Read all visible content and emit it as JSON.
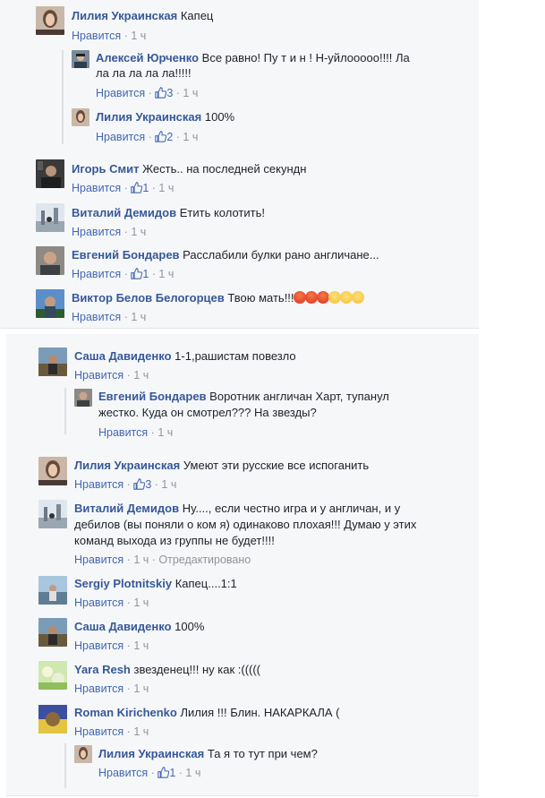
{
  "colors": {
    "name": "#365899",
    "link": "#4267b2",
    "meta": "#90949c",
    "panel": "#f6f7f9"
  },
  "panel1": {
    "c1": {
      "name": "Лилия Украинская",
      "text": "Капец",
      "like": "Нравится",
      "time": "1 ч"
    },
    "r1": {
      "name": "Алексей Юрченко",
      "text_l1": "Все равно! Пу т и н ! Н-уйлооооо!!!! Ла",
      "text_l2": "ла ла ла ла ла!!!!!",
      "like": "Нравится",
      "likes": "3",
      "time": "1 ч"
    },
    "r2": {
      "name": "Лилия Украинская",
      "text": "100%",
      "like": "Нравится",
      "likes": "2",
      "time": "1 ч"
    },
    "c2": {
      "name": "Игорь Смит",
      "text": "Жесть.. на последней секундн",
      "like": "Нравится",
      "likes": "1",
      "time": "1 ч"
    },
    "c3": {
      "name": "Виталий Демидов",
      "text": "Етить колотить!",
      "like": "Нравится",
      "time": "1 ч"
    },
    "c4": {
      "name": "Евгений Бондарев",
      "text": "Расслабили булки рано англичане...",
      "like": "Нравится",
      "likes": "1",
      "time": "1 ч"
    },
    "c5": {
      "name": "Виктор Белов Белогорцев",
      "text": "Твою мать!!!",
      "emoji": [
        "angry-emoji",
        "angry-emoji",
        "angry-emoji",
        "sad-emoji",
        "sad-emoji",
        "sad-emoji"
      ],
      "like": "Нравится",
      "time": "1 ч"
    }
  },
  "panel2": {
    "c1": {
      "name": "Саша Давиденко",
      "text": "1-1,рашистам повезло",
      "like": "Нравится",
      "time": "1 ч"
    },
    "r1": {
      "name": "Евгений Бондарев",
      "text_l1": "Воротник англичан Харт, тупанул",
      "text_l2": "жестко. Куда он смотрел??? На звезды?",
      "like": "Нравится",
      "time": "1 ч"
    },
    "c2": {
      "name": "Лилия Украинская",
      "text": "Умеют эти русские все испоганить",
      "like": "Нравится",
      "likes": "3",
      "time": "1 ч"
    },
    "c3": {
      "name": "Виталий Демидов",
      "text_l1": "Ну...., если честно игра и у англичан, и у",
      "text_l2": "дебилов (вы поняли о ком я) одинаково плохая!!! Думаю у этих",
      "text_l3": "команд выхода из группы не будет!!!!",
      "like": "Нравится",
      "time": "1 ч",
      "edited": "Отредактировано"
    },
    "c4": {
      "name": "Sergiy Plotnitskiy",
      "text": "Капец....1:1",
      "like": "Нравится",
      "time": "1 ч"
    },
    "c5": {
      "name": "Саша Давиденко",
      "text": "100%",
      "like": "Нравится",
      "time": "1 ч"
    },
    "c6": {
      "name": "Yara Resh",
      "text": "звезденец!!! ну как :(((((",
      "like": "Нравится",
      "time": "1 ч"
    },
    "c7": {
      "name": "Roman Kirichenko",
      "text": "Лилия !!! Блин. НАКАРКАЛА (",
      "like": "Нравится",
      "time": "1 ч"
    },
    "r2": {
      "name": "Лилия Украинская",
      "text": "Та я то тут при чем?",
      "like": "Нравится",
      "likes": "1",
      "time": "1 ч"
    }
  },
  "sep": "·"
}
